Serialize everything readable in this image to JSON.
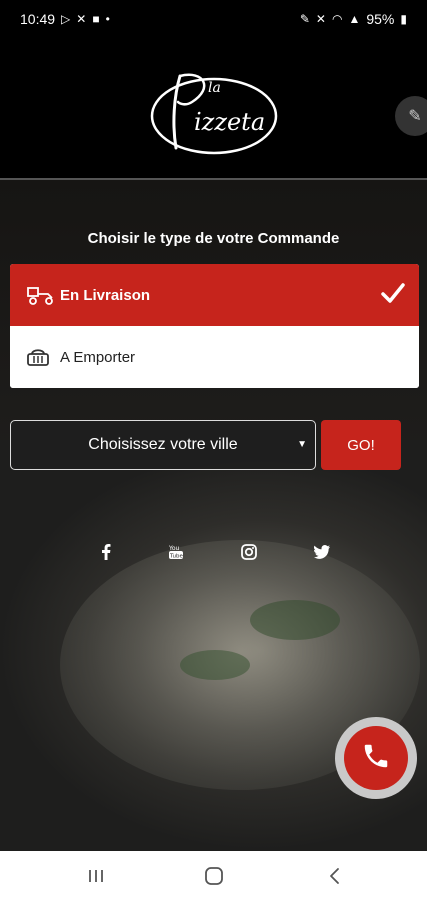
{
  "status_bar": {
    "time": "10:49",
    "battery": "95%"
  },
  "header": {
    "logo_text": "la Pizzeta"
  },
  "order": {
    "title": "Choisir le type de votre Commande",
    "options": [
      {
        "label": "En Livraison",
        "selected": true
      },
      {
        "label": "A Emporter",
        "selected": false
      }
    ]
  },
  "city": {
    "selected": "Choisissez votre ville",
    "go_label": "GO!"
  },
  "socials": [
    "facebook-icon",
    "youtube-icon",
    "instagram-icon",
    "twitter-icon"
  ],
  "colors": {
    "accent": "#c6241c",
    "background": "#000000"
  }
}
